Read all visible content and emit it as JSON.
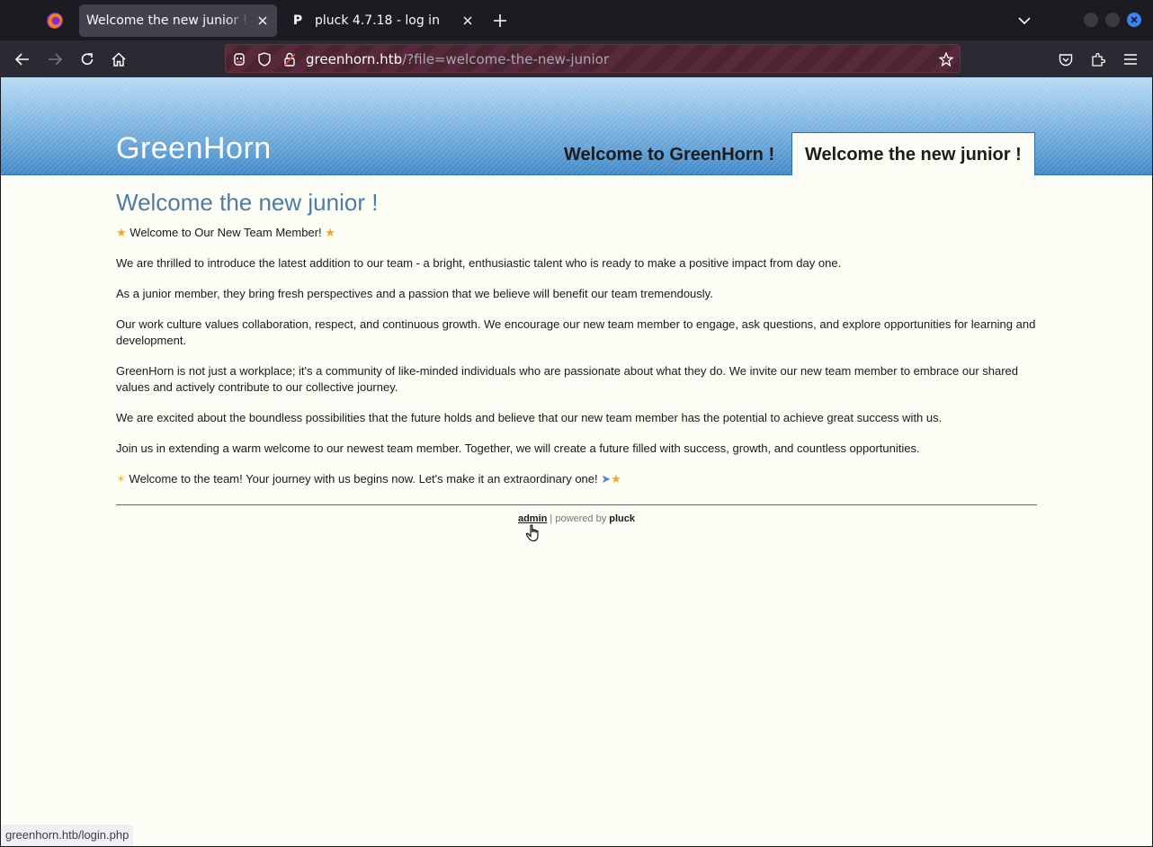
{
  "browser": {
    "tabs": [
      {
        "title": "Welcome the new junior ! - GreenHorn",
        "active": true
      },
      {
        "title": "pluck 4.7.18 - log in",
        "favicon": "P",
        "active": false
      }
    ],
    "url_host": "greenhorn.htb",
    "url_path": "/?file=welcome-the-new-junior",
    "status_url": "greenhorn.htb/login.php"
  },
  "site": {
    "title": "GreenHorn",
    "menu": [
      {
        "label": "Welcome to GreenHorn !",
        "active": false
      },
      {
        "label": "Welcome the new junior !",
        "active": true
      }
    ]
  },
  "article": {
    "heading": "Welcome the new junior !",
    "intro_text": "Welcome to Our New Team Member!",
    "paragraphs": [
      "We are thrilled to introduce the latest addition to our team - a bright, enthusiastic talent who is ready to make a positive impact from day one.",
      "As a junior member, they bring fresh perspectives and a passion that we believe will benefit our team tremendously.",
      "Our work culture values collaboration, respect, and continuous growth. We encourage our new team member to engage, ask questions, and explore opportunities for learning and development.",
      "GreenHorn is not just a workplace; it's a community of like-minded individuals who are passionate about what they do. We invite our new team member to embrace our shared values and actively contribute to our collective journey.",
      "We are excited about the boundless possibilities that the future holds and believe that our new team member has the potential to achieve great success with us.",
      "Join us in extending a warm welcome to our newest team member. Together, we will create a future filled with success, growth, and countless opportunities."
    ],
    "closing_text": "Welcome to the team! Your journey with us begins now. Let's make it an extraordinary one!"
  },
  "footer": {
    "admin_label": "admin",
    "separator": " | powered by ",
    "powered": "pluck"
  },
  "icons": [
    "firefox-icon",
    "close-icon",
    "plus-icon",
    "chevron-down-icon",
    "back-arrow-icon",
    "forward-arrow-icon",
    "reload-icon",
    "home-icon",
    "mask-icon",
    "shield-icon",
    "lock-icon",
    "star-icon",
    "pocket-icon",
    "extensions-icon",
    "menu-icon",
    "hand-cursor-icon",
    "star-emoji-icon",
    "clap-emoji-icon",
    "rocket-emoji-icon"
  ],
  "colors": {
    "heading": "#4f7ba4",
    "header_blue": "#5f9fd4",
    "page_bg": "#fcfdf5",
    "urlbar_stripe": "#57293a"
  }
}
